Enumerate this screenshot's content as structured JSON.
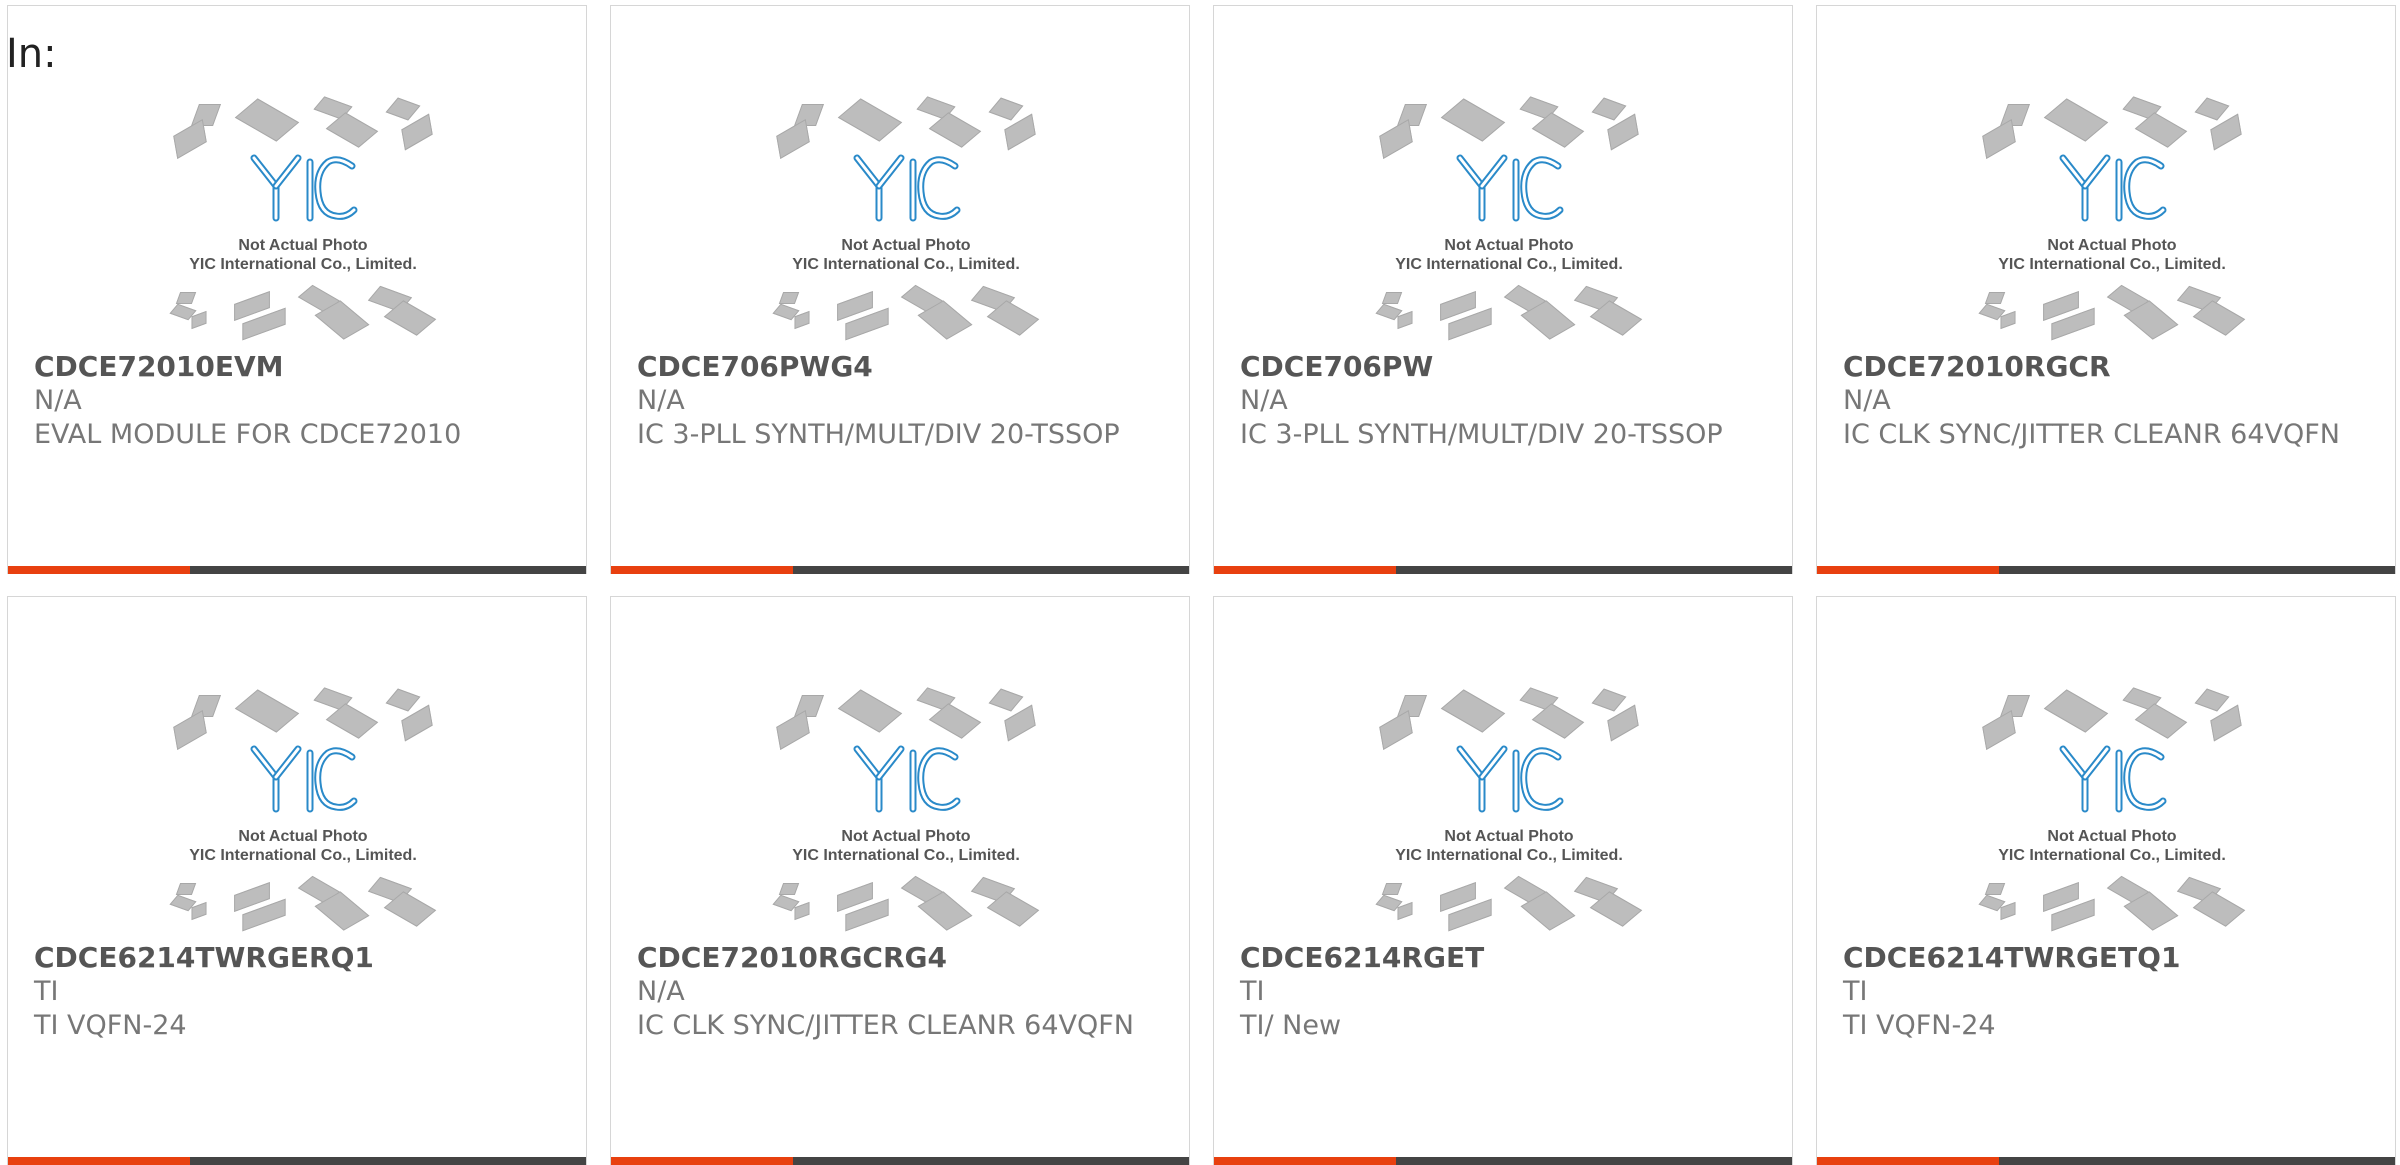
{
  "page": {
    "filter_label": "In:"
  },
  "photo_caption": {
    "line1": "Not Actual Photo",
    "line2": "YIC International Co., Limited."
  },
  "colors": {
    "accent": "#e8400f",
    "bar": "#444444",
    "logo_blue": "#2a8ac9"
  },
  "products": [
    {
      "part_number": "CDCE72010EVM",
      "manufacturer": "N/A",
      "description": "EVAL MODULE FOR CDCE72010"
    },
    {
      "part_number": "CDCE706PWG4",
      "manufacturer": "N/A",
      "description": "IC 3-PLL SYNTH/MULT/DIV 20-TSSOP"
    },
    {
      "part_number": "CDCE706PW",
      "manufacturer": "N/A",
      "description": "IC 3-PLL SYNTH/MULT/DIV 20-TSSOP"
    },
    {
      "part_number": "CDCE72010RGCR",
      "manufacturer": "N/A",
      "description": "IC CLK SYNC/JITTER CLEANR 64VQFN"
    },
    {
      "part_number": "CDCE6214TWRGERQ1",
      "manufacturer": "TI",
      "description": "TI VQFN-24"
    },
    {
      "part_number": "CDCE72010RGCRG4",
      "manufacturer": "N/A",
      "description": "IC CLK SYNC/JITTER CLEANR 64VQFN"
    },
    {
      "part_number": "CDCE6214RGET",
      "manufacturer": "TI",
      "description": "TI/ New"
    },
    {
      "part_number": "CDCE6214TWRGETQ1",
      "manufacturer": "TI",
      "description": "TI VQFN-24"
    }
  ]
}
